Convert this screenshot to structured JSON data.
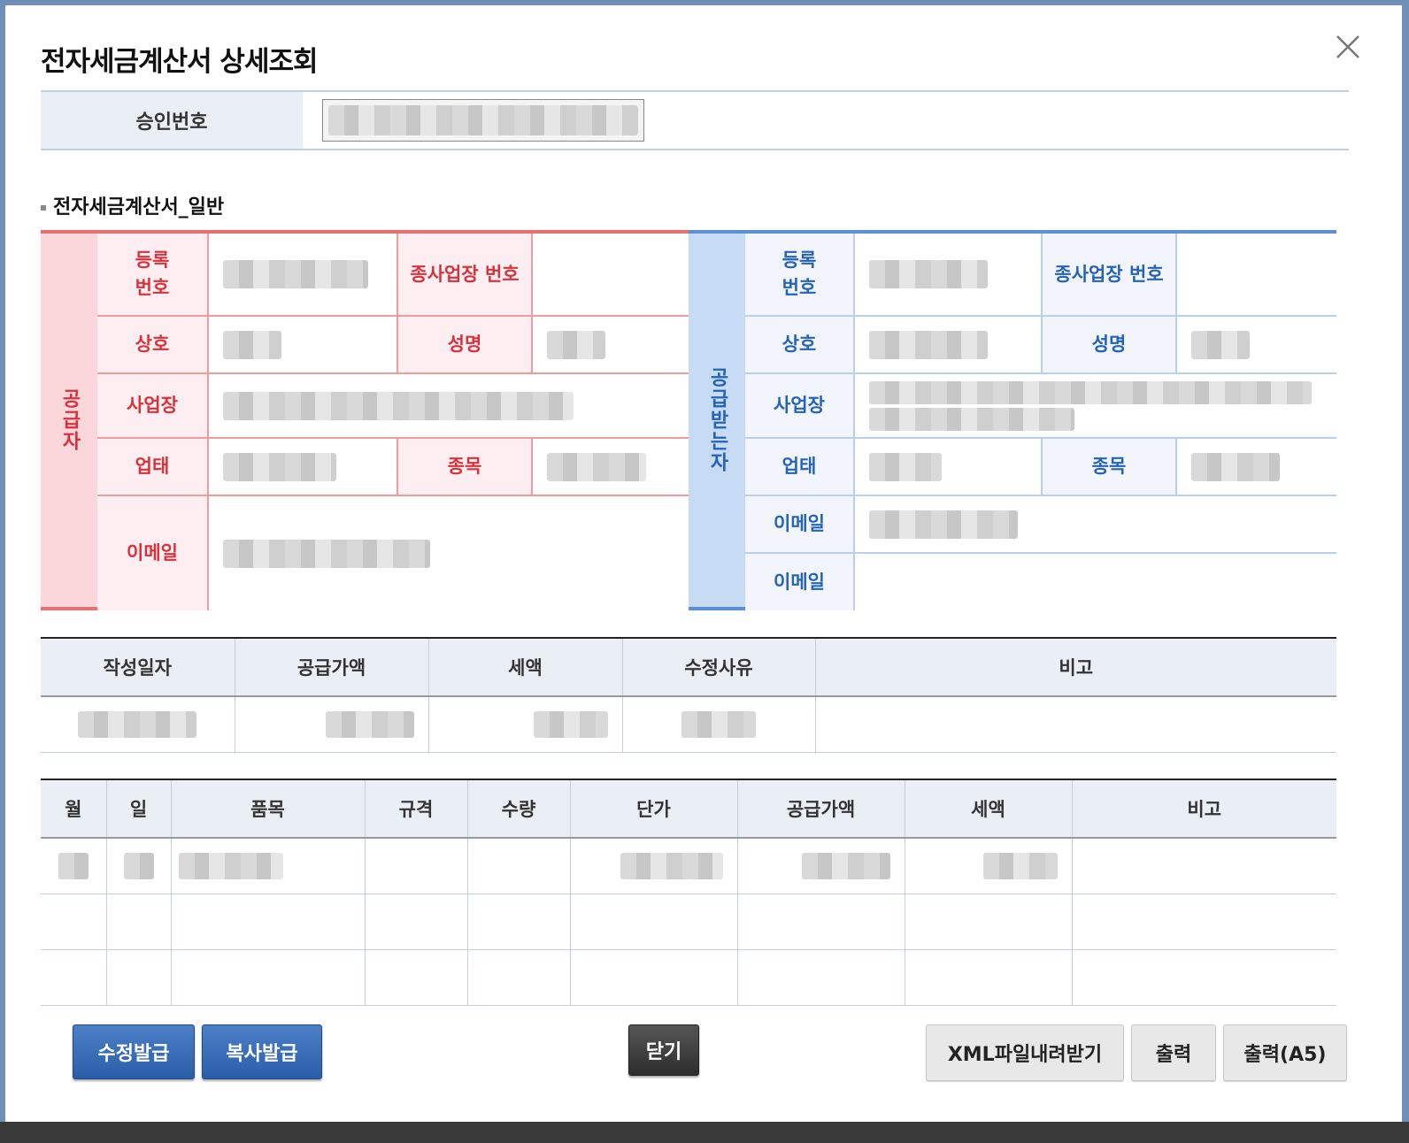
{
  "title": "전자세금계산서 상세조회",
  "approval": {
    "label": "승인번호"
  },
  "section_title": "전자세금계산서_일반",
  "supplier": {
    "side": "공급자",
    "reg_no": "등록\n번호",
    "branch_no": "종사업장 번호",
    "company": "상호",
    "name": "성명",
    "address": "사업장",
    "biz_type": "업태",
    "biz_item": "종목",
    "email": "이메일"
  },
  "buyer": {
    "side": "공급받는자",
    "reg_no": "등록\n번호",
    "branch_no": "종사업장 번호",
    "company": "상호",
    "name": "성명",
    "address": "사업장",
    "biz_type": "업태",
    "biz_item": "종목",
    "email1": "이메일",
    "email2": "이메일"
  },
  "summary": {
    "headers": [
      "작성일자",
      "공급가액",
      "세액",
      "수정사유",
      "비고"
    ]
  },
  "items": {
    "headers": [
      "월",
      "일",
      "품목",
      "규격",
      "수량",
      "단가",
      "공급가액",
      "세액",
      "비고"
    ]
  },
  "buttons": {
    "modify": "수정발급",
    "copy": "복사발급",
    "close": "닫기",
    "xml": "XML파일내려받기",
    "print": "출력",
    "print_a5": "출력(A5)"
  }
}
